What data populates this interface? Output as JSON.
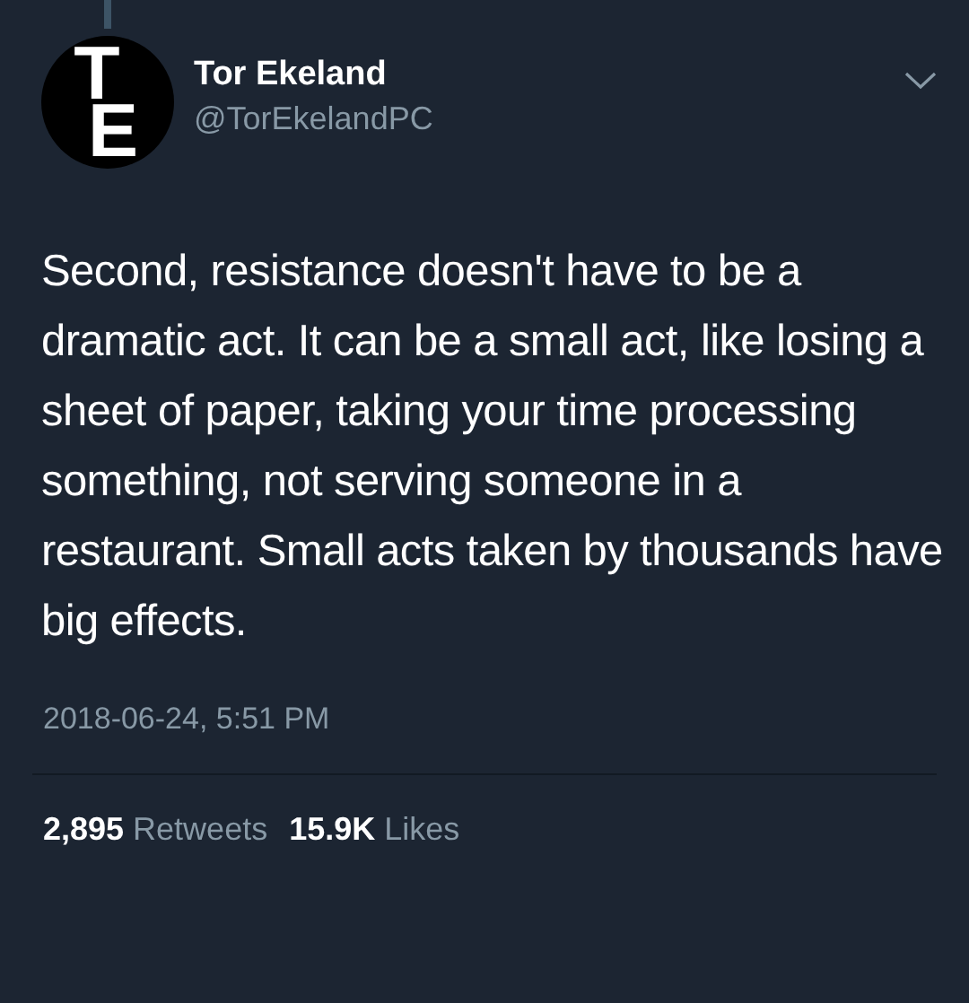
{
  "author": {
    "name": "Tor Ekeland",
    "handle": "@TorEkelandPC",
    "avatar_letters": [
      "T",
      "E"
    ]
  },
  "tweet": {
    "text": "Second, resistance doesn't have to be a dramatic act. It can be a small act, like losing a sheet of paper, taking your time processing something, not serving someone in a restaurant. Small acts taken by thousands have big effects.",
    "timestamp": "2018-06-24, 5:51 PM"
  },
  "stats": [
    {
      "count": "2,895",
      "label": "Retweets"
    },
    {
      "count": "15.9K",
      "label": "Likes"
    }
  ]
}
